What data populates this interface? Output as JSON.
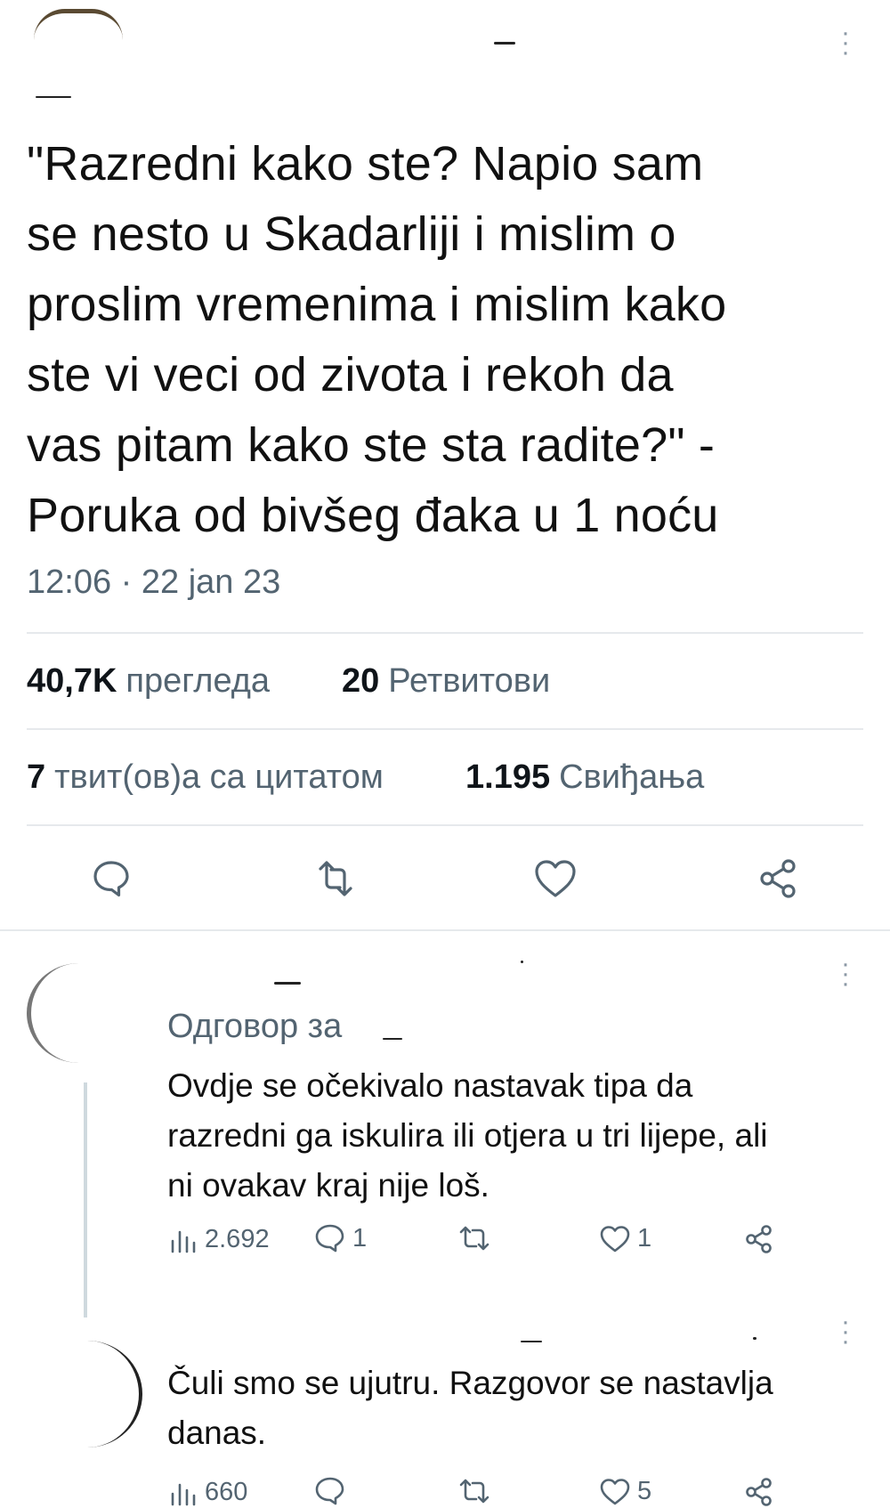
{
  "tweet": {
    "text_lines": [
      "\"Razredni kako ste? Napio sam",
      "se nesto u Skadarliji i mislim o",
      "proslim vremenima i mislim kako",
      "ste vi veci od zivota i rekoh da",
      "vas pitam kako ste sta radite?\" -",
      "Poruka od bivšeg đaka u 1 noću"
    ],
    "timestamp": "12:06 · 22 jan 23",
    "views_count": "40,7K",
    "views_label": "прегледа",
    "retweets_count": "20",
    "retweets_label": "Ретвитови",
    "quotes_count": "7",
    "quotes_label": "твит(ов)а са цитатом",
    "likes_count": "1.195",
    "likes_label": "Свиђања",
    "actions": [
      "reply-icon",
      "retweet-icon",
      "like-icon",
      "share-icon"
    ]
  },
  "replies": [
    {
      "reply_to_label": "Одговор за",
      "text_lines": [
        "Ovdje se očekivalo nastavak tipa da",
        "razredni ga iskulira ili otjera u tri lijepe, ali",
        "ni ovakav kraj nije loš."
      ],
      "views": "2.692",
      "replies": "1",
      "retweets": "",
      "likes": "1"
    },
    {
      "text_lines": [
        "Čuli smo se ujutru. Razgovor se nastavlja",
        "danas."
      ],
      "views": "660",
      "replies": "",
      "retweets": "",
      "likes": "5"
    }
  ],
  "colors": {
    "text": "#0f1419",
    "secondary": "#536471",
    "divider": "#e6e9ec"
  }
}
